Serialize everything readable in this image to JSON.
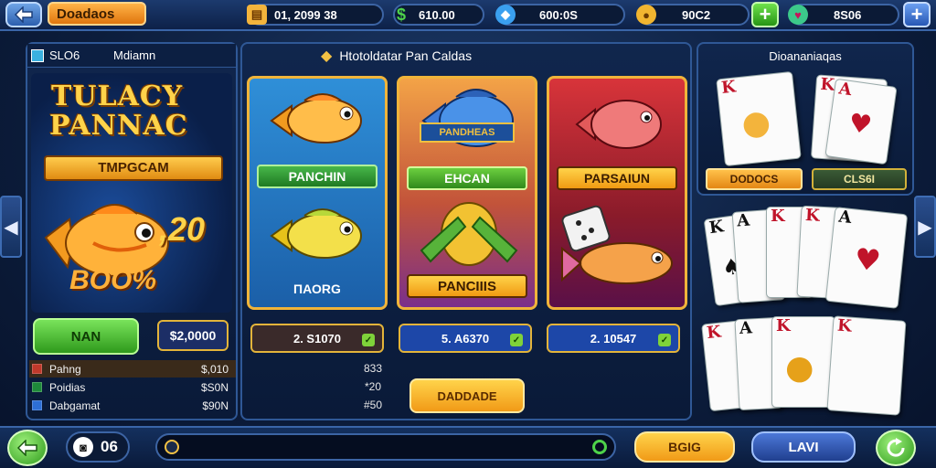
{
  "topbar": {
    "title": "Doadaos",
    "stats": [
      {
        "value": "01, 2099 38",
        "icon": "card-icon"
      },
      {
        "value": "610.00",
        "icon": "dollar-icon"
      },
      {
        "value": "600:0S",
        "icon": "gem-icon"
      },
      {
        "value": "90C2",
        "icon": "coin-icon"
      },
      {
        "value": "8S06",
        "icon": "gem-heart-icon"
      }
    ]
  },
  "left": {
    "header_tag": "SLO6",
    "header_label": "Mdiamn",
    "promo_title_1": "TULACY",
    "promo_title_2": "PANNAC",
    "promo_ribbon": "TMPGCAM",
    "promo_number": ",20",
    "promo_percent": "BOO%",
    "play_button": "NAN",
    "amount": "$2,0000",
    "list": [
      {
        "label": "Pahng",
        "value": "$,010",
        "color": "#c0392b"
      },
      {
        "label": "Poidias",
        "value": "$S0N",
        "color": "#1e8a3a"
      },
      {
        "label": "Dabgamat",
        "value": "$90N",
        "color": "#2d6fd6"
      }
    ]
  },
  "center": {
    "header": "Htotoldatar Pan Caldas",
    "cards": [
      {
        "label_top": "PANCHIN",
        "label_bottom": "ПАОRG",
        "value": "2. S1070"
      },
      {
        "label_top": "EHCAN",
        "label_bottom": "PANCIIIS",
        "emblem": "PANDHEAS",
        "value": "5. A6370"
      },
      {
        "label_top": "PARSAIUN",
        "value": "2. 10547"
      }
    ],
    "mini_values": [
      "833",
      "*20",
      "#50"
    ],
    "action_button": "DADDADE"
  },
  "right": {
    "header": "Dioananiaqas",
    "tab_1": "DODOCS",
    "tab_2": "CLS6I",
    "card_ranks": [
      "K",
      "K",
      "A",
      "K",
      "A",
      "K",
      "K",
      "A",
      "K",
      "A",
      "K",
      "K",
      "K",
      "K",
      "K"
    ]
  },
  "bottom": {
    "bet": "06",
    "coin_button": "BGIG",
    "play_button": "LAVI"
  },
  "colors": {
    "accent_gold": "#f0b43a",
    "accent_green": "#2f9a1c",
    "panel_bg": "#10264d"
  }
}
